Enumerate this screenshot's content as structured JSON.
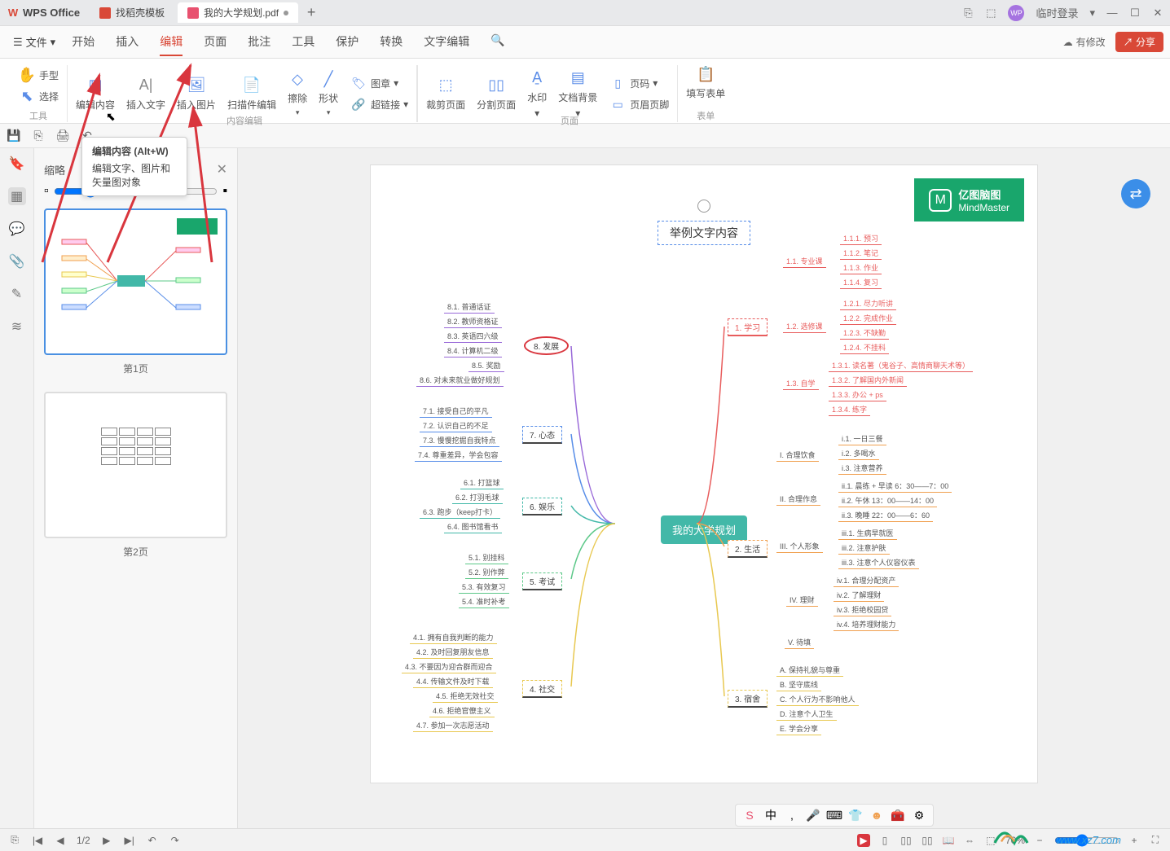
{
  "titlebar": {
    "app": "WPS Office",
    "tab1": "找稻壳模板",
    "tab2": "我的大学规划.pdf",
    "login": "临时登录"
  },
  "menubar": {
    "file": "文件",
    "tabs": [
      "开始",
      "插入",
      "编辑",
      "页面",
      "批注",
      "工具",
      "保护",
      "转换",
      "文字编辑"
    ],
    "active": 2,
    "changes": "有修改",
    "share": "分享"
  },
  "ribbon": {
    "g1a": "手型",
    "g1b": "选择",
    "g1lbl": "工具",
    "g2a": "编辑内容",
    "g2b": "插入文字",
    "g2c": "插入图片",
    "g2d": "扫描件编辑",
    "g2e": "擦除",
    "g2f": "形状",
    "g2g": "图章",
    "g2h": "超链接",
    "g2lbl": "内容编辑",
    "g3a": "裁剪页面",
    "g3b": "分割页面",
    "g3c": "水印",
    "g3d": "文档背景",
    "g3e": "页码",
    "g3f": "页眉页脚",
    "g3lbl": "页面",
    "g4a": "填写表单",
    "g4lbl": "表单"
  },
  "tooltip": {
    "title": "编辑内容 (Alt+W)",
    "body": "编辑文字、图片和矢量图对象"
  },
  "thumbs": {
    "title": "缩略",
    "p1": "第1页",
    "p2": "第2页"
  },
  "mindmap": {
    "logo1": "亿图脑图",
    "logo2": "MindMaster",
    "title": "举例文字内容",
    "center": "我的大学规划",
    "n8": "8. 发展",
    "n8_1": "8.1. 普通话证",
    "n8_2": "8.2. 教师资格证",
    "n8_3": "8.3. 英语四六级",
    "n8_4": "8.4. 计算机二级",
    "n8_5": "8.5. 奖励",
    "n8_6": "8.6. 对未来就业做好规划",
    "n7": "7. 心态",
    "n7_1": "7.1. 接受自己的平凡",
    "n7_2": "7.2. 认识自己的不足",
    "n7_3": "7.3. 慢慢挖掘自我特点",
    "n7_4": "7.4. 尊重差异，学会包容",
    "n6": "6. 娱乐",
    "n6_1": "6.1. 打篮球",
    "n6_2": "6.2. 打羽毛球",
    "n6_3": "6.3. 跑步（keep打卡）",
    "n6_4": "6.4. 图书馆看书",
    "n5": "5. 考试",
    "n5_1": "5.1. 别挂科",
    "n5_2": "5.2. 别作弊",
    "n5_3": "5.3. 有效复习",
    "n5_4": "5.4. 准时补考",
    "n4": "4. 社交",
    "n4_1": "4.1. 拥有自我判断的能力",
    "n4_2": "4.2. 及时回复朋友信息",
    "n4_3": "4.3. 不要因为迎合群而迎合",
    "n4_4": "4.4. 传输文件及时下载",
    "n4_5": "4.5. 拒绝无效社交",
    "n4_6": "4.6. 拒绝官僚主义",
    "n4_7": "4.7. 参加一次志愿活动",
    "n1": "1. 学习",
    "n1_1": "1.1. 专业课",
    "n1_1_1": "1.1.1. 预习",
    "n1_1_2": "1.1.2. 笔记",
    "n1_1_3": "1.1.3. 作业",
    "n1_1_4": "1.1.4. 复习",
    "n1_2": "1.2. 选修课",
    "n1_2_1": "1.2.1. 尽力听讲",
    "n1_2_2": "1.2.2. 完成作业",
    "n1_2_3": "1.2.3. 不缺勤",
    "n1_2_4": "1.2.4. 不挂科",
    "n1_3": "1.3. 自学",
    "n1_3_1": "1.3.1. 读名著（鬼谷子、高情商聊天术等）",
    "n1_3_2": "1.3.2. 了解国内外新闻",
    "n1_3_3": "1.3.3. 办公 + ps",
    "n1_3_4": "1.3.4. 练字",
    "n2": "2. 生活",
    "n2_1": "I. 合理饮食",
    "n2_1_1": "i.1. 一日三餐",
    "n2_1_2": "i.2. 多喝水",
    "n2_1_3": "i.3. 注意营养",
    "n2_2": "II. 合理作息",
    "n2_2_1": "ii.1. 晨练 + 早读 6：30——7：00",
    "n2_2_2": "ii.2. 午休 13：00——14：00",
    "n2_2_3": "ii.3. 晚睡 22：00——6：60",
    "n2_3": "III. 个人形象",
    "n2_3_1": "iii.1. 生病早就医",
    "n2_3_2": "iii.2. 注意护肤",
    "n2_3_3": "iii.3. 注意个人仪容仪表",
    "n2_4": "IV. 理财",
    "n2_4_1": "iv.1. 合理分配资产",
    "n2_4_2": "iv.2. 了解理财",
    "n2_4_3": "iv.3. 拒绝校园贷",
    "n2_4_4": "iv.4. 培养理财能力",
    "n2_5": "V. 待填",
    "n3": "3. 宿舍",
    "n3_1": "A. 保持礼貌与尊重",
    "n3_2": "B. 坚守底线",
    "n3_3": "C. 个人行为不影响他人",
    "n3_4": "D. 注意个人卫生",
    "n3_5": "E. 学会分享"
  },
  "status": {
    "page": "1/2",
    "zoom": "70%",
    "sheet": "1/2"
  },
  "watermark": "www.xz7.com"
}
